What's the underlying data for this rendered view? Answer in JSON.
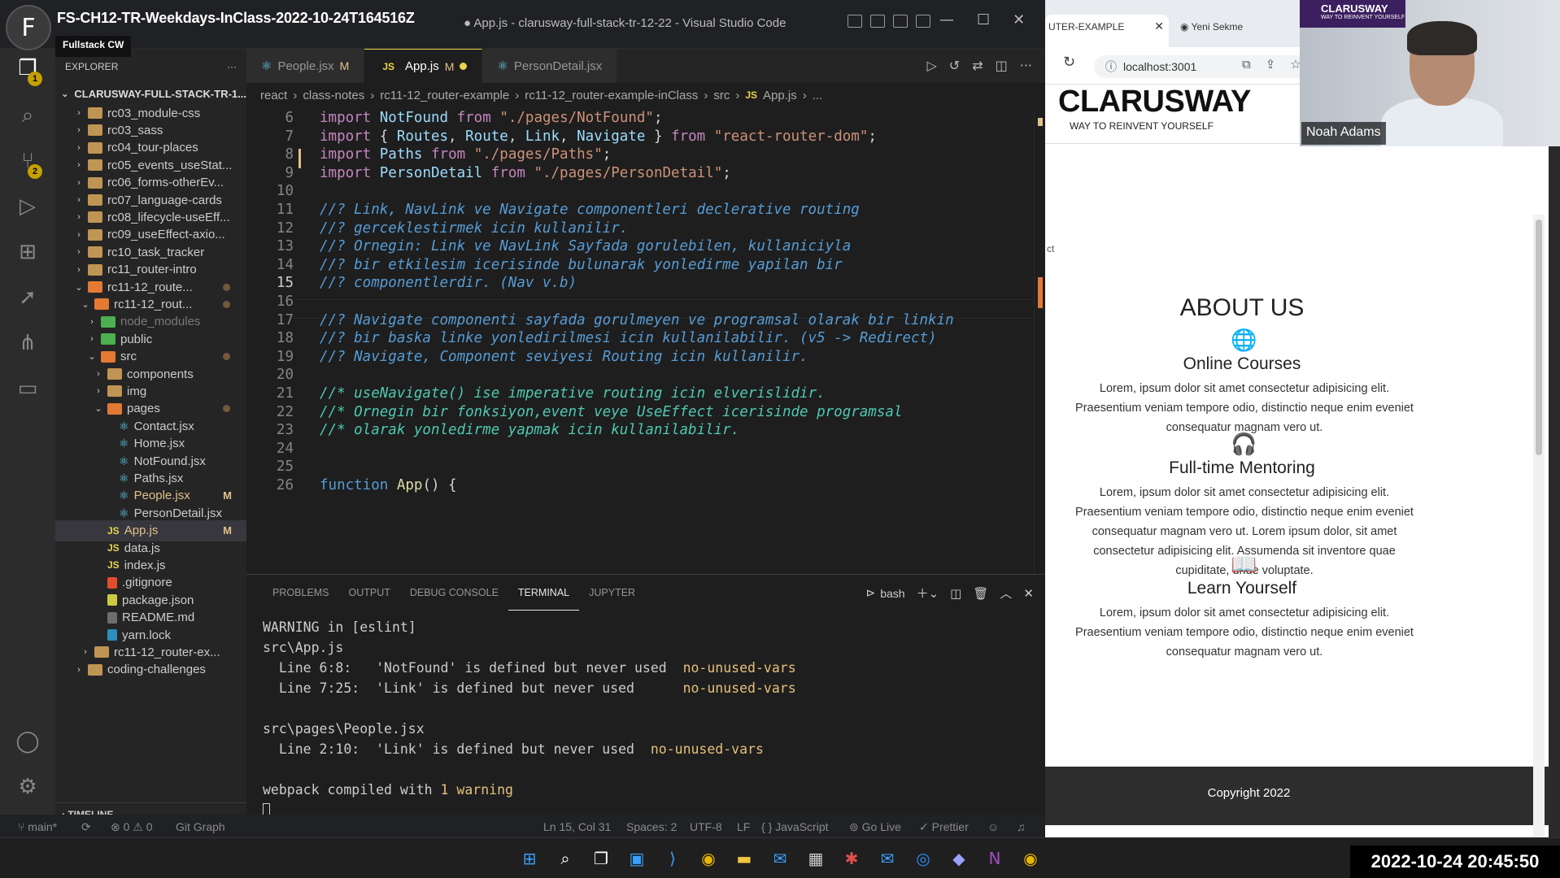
{
  "meeting": {
    "title": "FS-CH12-TR-Weekdays-InClass-2022-10-24T164516Z",
    "org_badge": "Fullstack CW",
    "avatar_letter": "F"
  },
  "vscode": {
    "window_title": "● App.js - clarusway-full-stack-tr-12-22 - Visual Studio Code",
    "activity_badges": {
      "explorer": "1",
      "source_control": "2"
    },
    "explorer": {
      "header": "EXPLORER",
      "more": "···",
      "workspace": "CLARUSWAY-FULL-STACK-TR-1...",
      "items": [
        {
          "label": "rc03_module-css",
          "type": "folder"
        },
        {
          "label": "rc03_sass",
          "type": "folder"
        },
        {
          "label": "rc04_tour-places",
          "type": "folder"
        },
        {
          "label": "rc05_events_useStat...",
          "type": "folder"
        },
        {
          "label": "rc06_forms-otherEv...",
          "type": "folder"
        },
        {
          "label": "rc07_language-cards",
          "type": "folder"
        },
        {
          "label": "rc08_lifecycle-useEff...",
          "type": "folder"
        },
        {
          "label": "rc09_useEffect-axio...",
          "type": "folder"
        },
        {
          "label": "rc10_task_tracker",
          "type": "folder"
        },
        {
          "label": "rc11_router-intro",
          "type": "folder"
        },
        {
          "label": "rc11-12_route...",
          "type": "folder-open"
        },
        {
          "label": "rc11-12_rout...",
          "type": "folder-open"
        },
        {
          "label": "node_modules",
          "type": "folder"
        },
        {
          "label": "public",
          "type": "folder"
        },
        {
          "label": "src",
          "type": "folder-open"
        },
        {
          "label": "components",
          "type": "folder"
        },
        {
          "label": "img",
          "type": "folder"
        },
        {
          "label": "pages",
          "type": "folder-open"
        },
        {
          "label": "Contact.jsx",
          "type": "react"
        },
        {
          "label": "Home.jsx",
          "type": "react"
        },
        {
          "label": "NotFound.jsx",
          "type": "react"
        },
        {
          "label": "Paths.jsx",
          "type": "react"
        },
        {
          "label": "People.jsx",
          "type": "react",
          "status": "M"
        },
        {
          "label": "PersonDetail.jsx",
          "type": "react"
        },
        {
          "label": "App.js",
          "type": "js",
          "status": "M"
        },
        {
          "label": "data.js",
          "type": "js"
        },
        {
          "label": "index.js",
          "type": "js"
        },
        {
          "label": ".gitignore",
          "type": "git"
        },
        {
          "label": "package.json",
          "type": "json"
        },
        {
          "label": "README.md",
          "type": "md"
        },
        {
          "label": "yarn.lock",
          "type": "yarn"
        },
        {
          "label": "rc11-12_router-ex...",
          "type": "folder"
        },
        {
          "label": "coding-challenges",
          "type": "folder"
        }
      ],
      "timeline": "TIMELINE"
    },
    "tabs": [
      {
        "label": "People.jsx",
        "status": "M",
        "icon": "react-icon"
      },
      {
        "label": "App.js",
        "status": "M",
        "icon": "js-icon",
        "active": true
      },
      {
        "label": "PersonDetail.jsx",
        "icon": "react-icon"
      }
    ],
    "breadcrumb": [
      "react",
      "class-notes",
      "rc11-12_router-example",
      "rc11-12_router-example-inClass",
      "src",
      "App.js",
      "..."
    ],
    "code": [
      {
        "n": "6",
        "t": "import NotFound from \"./pages/NotFound\";"
      },
      {
        "n": "7",
        "t": "import { Routes, Route, Link, Navigate } from \"react-router-dom\";"
      },
      {
        "n": "8",
        "t": "import Paths from \"./pages/Paths\";"
      },
      {
        "n": "9",
        "t": "import PersonDetail from \"./pages/PersonDetail\";"
      },
      {
        "n": "10",
        "t": ""
      },
      {
        "n": "11",
        "t": "//? Link, NavLink ve Navigate componentleri declerative routing"
      },
      {
        "n": "12",
        "t": "//? gerceklestirmek icin kullanilir."
      },
      {
        "n": "13",
        "t": "//? Ornegin: Link ve NavLink Sayfada gorulebilen, kullaniciyla"
      },
      {
        "n": "14",
        "t": "//? bir etkilesim icerisinde bulunarak yonledirme yapilan bir"
      },
      {
        "n": "15",
        "t": "//? componentlerdir. (Nav v.b)"
      },
      {
        "n": "16",
        "t": ""
      },
      {
        "n": "17",
        "t": "//? Navigate componenti sayfada gorulmeyen ve programsal olarak bir linkin"
      },
      {
        "n": "18",
        "t": "//? bir baska linke yonledirilmesi icin kullanilabilir. (v5 -> Redirect)"
      },
      {
        "n": "19",
        "t": "//? Navigate, Component seviyesi Routing icin kullanilir."
      },
      {
        "n": "20",
        "t": ""
      },
      {
        "n": "21",
        "t": "//* useNavigate() ise imperative routing icin elverislidir."
      },
      {
        "n": "22",
        "t": "//* Ornegin bir fonksiyon,event veye UseEffect icerisinde programsal"
      },
      {
        "n": "23",
        "t": "//* olarak yonledirme yapmak icin kullanilabilir."
      },
      {
        "n": "24",
        "t": ""
      },
      {
        "n": "25",
        "t": ""
      },
      {
        "n": "26",
        "t": "function App() {"
      }
    ],
    "panel": {
      "tabs": [
        "PROBLEMS",
        "OUTPUT",
        "DEBUG CONSOLE",
        "TERMINAL",
        "JUPYTER"
      ],
      "active_tab": "TERMINAL",
      "shell": "bash",
      "terminal": [
        {
          "a": "WARNING in [eslint]",
          "b": ""
        },
        {
          "a": "src\\App.js",
          "b": ""
        },
        {
          "a": "  Line 6:8:   'NotFound' is defined but never used  ",
          "b": "no-unused-vars"
        },
        {
          "a": "  Line 7:25:  'Link' is defined but never used      ",
          "b": "no-unused-vars"
        },
        {
          "a": "",
          "b": ""
        },
        {
          "a": "src\\pages\\People.jsx",
          "b": ""
        },
        {
          "a": "  Line 2:10:  'Link' is defined but never used  ",
          "b": "no-unused-vars"
        },
        {
          "a": "",
          "b": ""
        },
        {
          "a": "webpack compiled with ",
          "b": "1 warning"
        }
      ]
    },
    "status": {
      "branch": "main*",
      "errors": "⊗ 0 ⚠ 0",
      "git_graph": "Git Graph",
      "position": "Ln 15, Col 31",
      "spaces": "Spaces: 2",
      "encoding": "UTF-8",
      "eol": "LF",
      "language": "{ } JavaScript",
      "go_live": "Go Live",
      "prettier": "✓ Prettier"
    }
  },
  "browser": {
    "tab_active": "UTER-EXAMPLE",
    "tab_new": "Yeni Sekme",
    "url": "localhost:3001",
    "site": {
      "logo": "CLARUSWAY",
      "logo_sub": "WAY TO REINVENT YOURSELF",
      "left_text": "ct",
      "about_title": "ABOUT US",
      "sections": [
        {
          "icon": "globe-icon",
          "title": "Online Courses",
          "text": "Lorem, ipsum dolor sit amet consectetur adipisicing elit. Praesentium veniam tempore odio, distinctio neque enim eveniet consequatur magnam vero ut."
        },
        {
          "icon": "headset-icon",
          "title": "Full-time Mentoring",
          "text": "Lorem, ipsum dolor sit amet consectetur adipisicing elit. Praesentium veniam tempore odio, distinctio neque enim eveniet consequatur magnam vero ut. Lorem ipsum dolor, sit amet consectetur adipisicing elit. Assumenda sit inventore quae cupiditate, unde voluptate."
        },
        {
          "icon": "book-icon",
          "title": "Learn Yourself",
          "text": "Lorem, ipsum dolor sit amet consectetur adipisicing elit. Praesentium veniam tempore odio, distinctio neque enim eveniet consequatur magnam vero ut."
        }
      ],
      "footer": "Copyright 2022"
    }
  },
  "webcam": {
    "name": "Noah Adams",
    "logo": "CLARUSWAY",
    "logo_sub": "WAY TO REINVENT YOURSELF"
  },
  "taskbar": {
    "clock": "2022-10-24  20:45:50"
  }
}
